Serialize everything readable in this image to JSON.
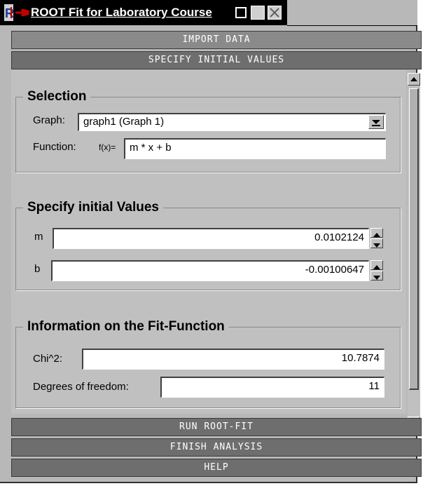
{
  "window": {
    "title": "ROOT Fit for Laboratory Course"
  },
  "panels": {
    "import": "IMPORT DATA",
    "specify": "SPECIFY INITIAL VALUES",
    "run": "RUN ROOT-FIT",
    "finish": "FINISH ANALYSIS",
    "help": "HELP"
  },
  "selection": {
    "title": "Selection",
    "graph_label": "Graph:",
    "graph_value": "graph1 (Graph 1)",
    "function_label": "Function:",
    "function_prefix": "f(x)=",
    "function_value": "m * x + b"
  },
  "initial_values": {
    "title": "Specify initial Values",
    "params": [
      {
        "name": "m",
        "value": "0.0102124"
      },
      {
        "name": "b",
        "value": "-0.00100647"
      }
    ]
  },
  "fit_info": {
    "title": "Information on the Fit-Function",
    "chi2_label": "Chi^2:",
    "chi2_value": "10.7874",
    "dof_label": "Degrees of freedom:",
    "dof_value": "11"
  },
  "icons": {
    "app": "root-app-icon",
    "pin": "pin-icon",
    "minimize": "minimize-icon",
    "maximize": "maximize-icon",
    "close": "close-icon"
  }
}
